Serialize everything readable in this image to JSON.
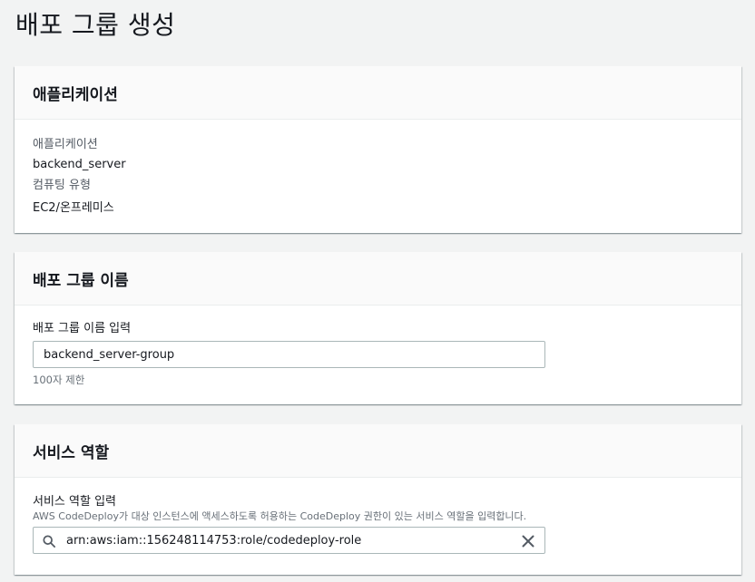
{
  "page": {
    "title": "배포 그룹 생성"
  },
  "application_section": {
    "header": "애플리케이션",
    "app_label": "애플리케이션",
    "app_value": "backend_server",
    "compute_label": "컴퓨팅 유형",
    "compute_value": "EC2/온프레미스"
  },
  "group_name_section": {
    "header": "배포 그룹 이름",
    "input_label": "배포 그룹 이름 입력",
    "input_value": "backend_server-group",
    "constraint": "100자 제한"
  },
  "service_role_section": {
    "header": "서비스 역할",
    "input_label": "서비스 역할 입력",
    "description": "AWS CodeDeploy가 대상 인스턴스에 액세스하도록 허용하는 CodeDeploy 권한이 있는 서비스 역할을 입력합니다.",
    "input_value": "arn:aws:iam::156248114753:role/codedeploy-role"
  },
  "icons": {
    "search": "search-icon",
    "clear": "close-icon"
  },
  "colors": {
    "background": "#f2f3f3",
    "card": "#ffffff",
    "header": "#fafafa",
    "border": "#aab7b8"
  }
}
